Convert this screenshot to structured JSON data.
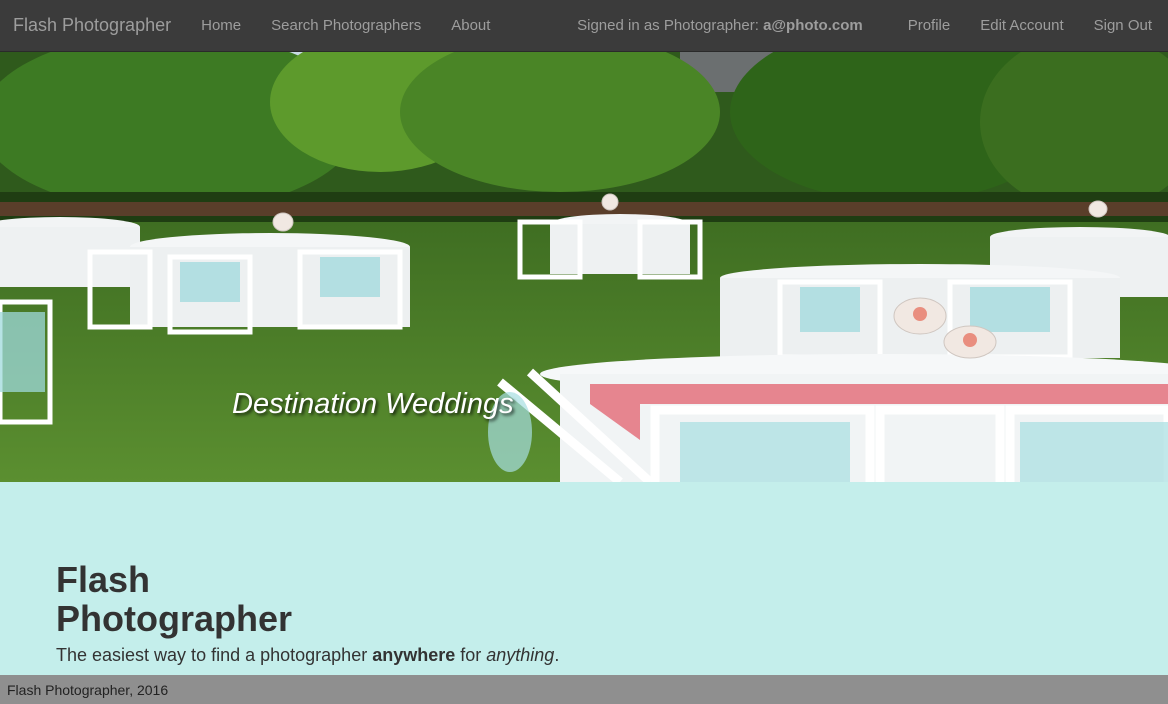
{
  "navbar": {
    "brand": "Flash Photographer",
    "links": [
      "Home",
      "Search Photographers",
      "About"
    ],
    "signed_in_prefix": "Signed in as Photographer:",
    "signed_in_user": "a@photo.com",
    "right_links": [
      "Profile",
      "Edit Account",
      "Sign Out"
    ]
  },
  "hero": {
    "caption": "Destination Weddings"
  },
  "jumbotron": {
    "title_line1": "Flash",
    "title_line2": "Photographer",
    "tagline_start": "The easiest way to find a photographer ",
    "tagline_bold": "anywhere",
    "tagline_mid": " for ",
    "tagline_italic": "anything",
    "tagline_end": "."
  },
  "footer": {
    "text": "Flash Photographer, 2016"
  },
  "colors": {
    "navbar_bg": "#3b3b3b",
    "nav_text": "#9d9d9d",
    "jumbotron_bg": "#c4eeeb",
    "footer_bg": "#8f8f8f"
  }
}
